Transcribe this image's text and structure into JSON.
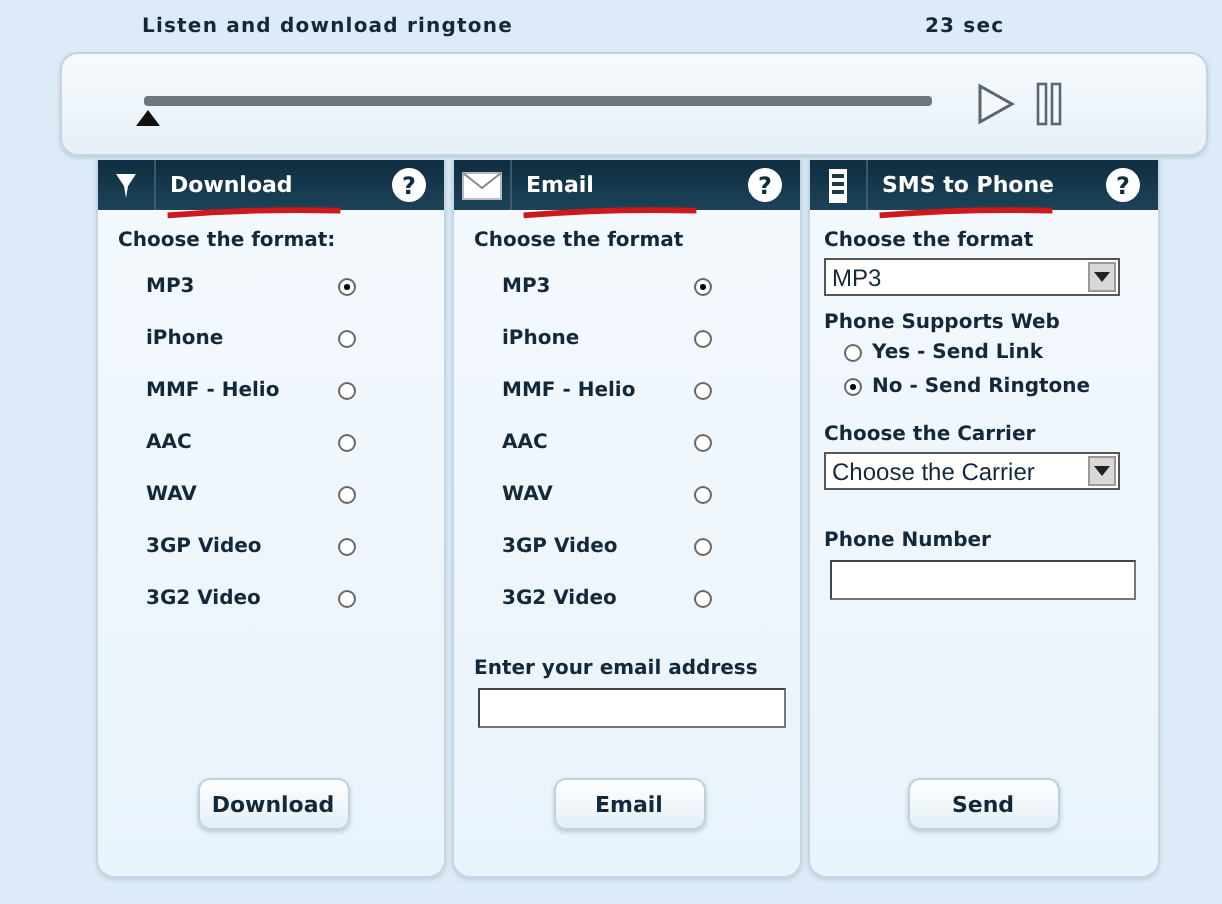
{
  "heading": "Listen and download ringtone",
  "duration": "23 sec",
  "player": {
    "level": 0
  },
  "panels": [
    {
      "kind": "formats",
      "title": "Download",
      "help": "?",
      "prompt": "Choose the format:",
      "options": [
        {
          "label": "MP3",
          "selected": true
        },
        {
          "label": "iPhone",
          "selected": false
        },
        {
          "label": "MMF - Helio",
          "selected": false
        },
        {
          "label": "AAC",
          "selected": false
        },
        {
          "label": "WAV",
          "selected": false
        },
        {
          "label": "3GP Video",
          "selected": false
        },
        {
          "label": "3G2 Video",
          "selected": false
        }
      ],
      "button": "Download"
    },
    {
      "kind": "formats",
      "title": "Email",
      "help": "?",
      "prompt": "Choose the format",
      "options": [
        {
          "label": "MP3",
          "selected": true
        },
        {
          "label": "iPhone",
          "selected": false
        },
        {
          "label": "MMF - Helio",
          "selected": false
        },
        {
          "label": "AAC",
          "selected": false
        },
        {
          "label": "WAV",
          "selected": false
        },
        {
          "label": "3GP Video",
          "selected": false
        },
        {
          "label": "3G2 Video",
          "selected": false
        }
      ],
      "email_label": "Enter your email address",
      "button": "Email"
    },
    {
      "kind": "sms",
      "title": "SMS to Phone",
      "help": "?",
      "format_label": "Choose the format",
      "format_value": "MP3",
      "web_label": "Phone Supports Web",
      "web_options": [
        {
          "label": "Yes - Send Link",
          "selected": false
        },
        {
          "label": "No - Send Ringtone",
          "selected": true
        }
      ],
      "carrier_label": "Choose the Carrier",
      "carrier_value": "Choose the Carrier",
      "phone_label": "Phone Number",
      "button": "Send"
    }
  ]
}
